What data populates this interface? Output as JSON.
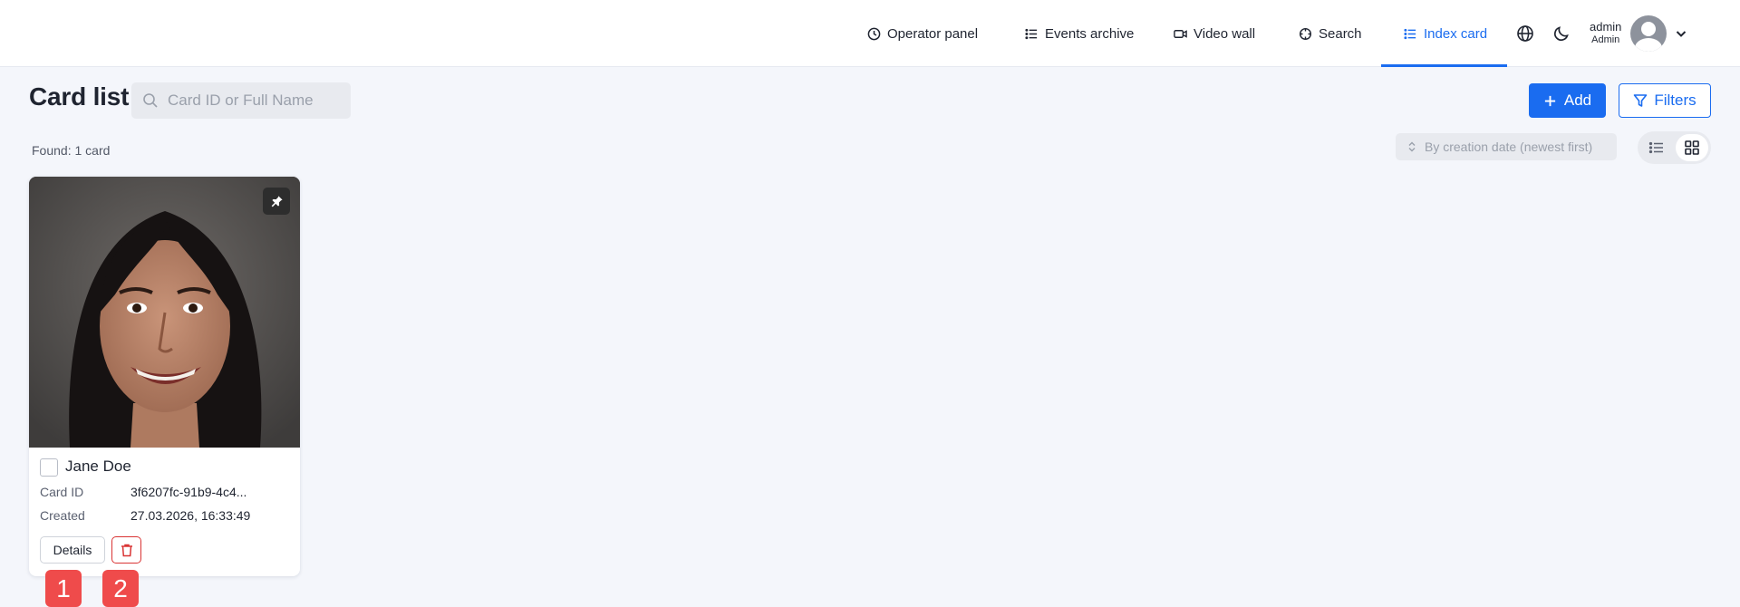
{
  "nav": {
    "items": [
      {
        "label": "Operator panel",
        "icon": "clock-icon"
      },
      {
        "label": "Events archive",
        "icon": "list-icon"
      },
      {
        "label": "Video wall",
        "icon": "video-camera-icon"
      },
      {
        "label": "Search",
        "icon": "crosshair-icon"
      },
      {
        "label": "Index card",
        "icon": "list-icon",
        "active": true
      }
    ],
    "language_icon": "globe-icon",
    "theme_icon": "moon-icon",
    "user": {
      "name": "admin",
      "role": "Admin"
    }
  },
  "header": {
    "title": "Card list",
    "search_placeholder": "Card ID or Full Name",
    "search_value": "",
    "add_label": "Add",
    "filters_label": "Filters"
  },
  "toolbar": {
    "found": "Found: 1 card",
    "sort_label": "By creation date (newest first)",
    "active_view": "grid"
  },
  "cards": [
    {
      "name": "Jane Doe",
      "checked": false,
      "card_id_label": "Card ID",
      "card_id": "3f6207fc-91b9-4c4...",
      "created_label": "Created",
      "created": "27.03.2026, 16:33:49",
      "details_label": "Details"
    }
  ],
  "markers": [
    "1",
    "2"
  ],
  "colors": {
    "accent": "#1a6cf0",
    "danger": "#d93434",
    "marker": "#ef4b4b",
    "background": "#f4f6fb"
  }
}
